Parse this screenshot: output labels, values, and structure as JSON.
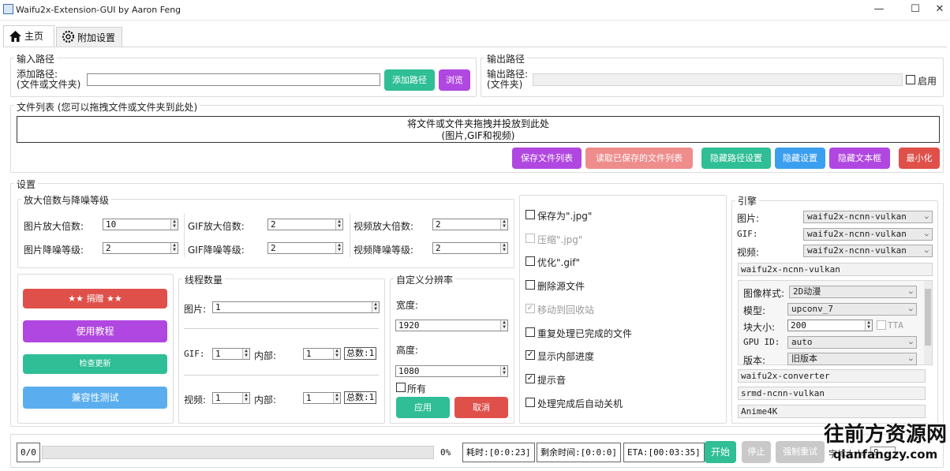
{
  "window": {
    "title": "Waifu2x-Extension-GUI by Aaron Feng",
    "minimize": "—",
    "maximize": "☐",
    "close": "✕"
  },
  "tabs": [
    {
      "label": "主页",
      "icon": "home-icon"
    },
    {
      "label": "附加设置",
      "icon": "gear-icon"
    }
  ],
  "input_path": {
    "group": "输入路径",
    "label": "添加路径:\n(文件或文件夹)",
    "value": "",
    "add_button": "添加路径",
    "browse_button": "浏览"
  },
  "output_path": {
    "group": "输出路径",
    "label": "输出路径:\n(文件夹)",
    "value": "",
    "enable_label": "启用",
    "enabled": false
  },
  "file_list": {
    "group": "文件列表 (您可以拖拽文件或文件夹到此处)",
    "drop_line1": "将文件或文件夹拖拽并投放到此处",
    "drop_line2": "(图片,GIF和视频)",
    "buttons": {
      "save": "保存文件列表",
      "load": "读取已保存的文件列表",
      "hide_path": "隐藏路径设置",
      "hide_settings": "隐藏设置",
      "hide_text": "隐藏文本框",
      "minimize": "最小化"
    }
  },
  "settings": {
    "group": "设置",
    "scale": {
      "group": "放大倍数与降噪等级",
      "image_scale_label": "图片放大倍数:",
      "image_scale": "10",
      "image_noise_label": "图片降噪等级:",
      "image_noise": "2",
      "gif_scale_label": "GIF放大倍数:",
      "gif_scale": "2",
      "gif_noise_label": "GIF降噪等级:",
      "gif_noise": "2",
      "video_scale_label": "视频放大倍数:",
      "video_scale": "2",
      "video_noise_label": "视频降噪等级:",
      "video_noise": "2"
    },
    "left_buttons": {
      "donate": "★★ 捐赠 ★★",
      "tutorial": "使用教程",
      "check_update": "检查更新",
      "compat_test": "兼容性测试"
    },
    "threads": {
      "group": "线程数量",
      "image_label": "图片:",
      "image": "1",
      "gif_label": "GIF:",
      "gif": "1",
      "gif_inner_label": "内部:",
      "gif_inner": "1",
      "gif_total": "总数:1",
      "video_label": "视频:",
      "video": "1",
      "video_inner_label": "内部:",
      "video_inner": "1",
      "video_total": "总数:1"
    },
    "resolution": {
      "group": "自定义分辨率",
      "width_label": "宽度:",
      "width": "1920",
      "height_label": "高度:",
      "height": "1080",
      "all_label": "所有",
      "apply": "应用",
      "cancel": "取消"
    },
    "options": [
      {
        "label": "保存为\".jpg\"",
        "checked": false,
        "disabled": false
      },
      {
        "label": "压缩\".jpg\"",
        "checked": false,
        "disabled": true
      },
      {
        "label": "优化\".gif\"",
        "checked": false,
        "disabled": false
      },
      {
        "label": "删除源文件",
        "checked": false,
        "disabled": false
      },
      {
        "label": "移动到回收站",
        "checked": true,
        "disabled": true
      },
      {
        "label": "重复处理已完成的文件",
        "checked": false,
        "disabled": false
      },
      {
        "label": "显示内部进度",
        "checked": true,
        "disabled": false
      },
      {
        "label": "提示音",
        "checked": true,
        "disabled": false
      },
      {
        "label": "处理完成后自动关机",
        "checked": false,
        "disabled": false
      }
    ],
    "engine": {
      "group": "引擎",
      "image_label": "图片:",
      "image": "waifu2x-ncnn-vulkan",
      "gif_label": "GIF:",
      "gif": "waifu2x-ncnn-vulkan",
      "video_label": "视频:",
      "video": "waifu2x-ncnn-vulkan",
      "sections": [
        "waifu2x-ncnn-vulkan",
        "waifu2x-converter",
        "srmd-ncnn-vulkan",
        "Anime4K"
      ],
      "style_label": "图像样式:",
      "style": "2D动漫",
      "model_label": "模型:",
      "model": "upconv_7",
      "tile_label": "块大小:",
      "tile": "200",
      "tta_label": "TTA",
      "gpu_label": "GPU ID:",
      "gpu": "auto",
      "version_label": "版本:",
      "version": "旧版本"
    }
  },
  "status": {
    "count": "0/0",
    "percent": "0%",
    "elapsed": "耗时:[0:0:23]",
    "remaining": "剩余时间:[0:0:0]",
    "eta": "ETA:[00:03:35]",
    "start": "开始",
    "stop": "停止",
    "force_retry": "强制重试",
    "font_label": "字体大小",
    "font_size": "9"
  },
  "watermark": {
    "line1": "往前方资源网",
    "line2": "qianfangzy.com"
  },
  "colors": {
    "teal": "#2fbe95",
    "purple": "#b047e0",
    "pink": "#ef8c8c",
    "red": "#e0504a",
    "blue": "#3b9ff0",
    "lightblue": "#5aaeef"
  }
}
